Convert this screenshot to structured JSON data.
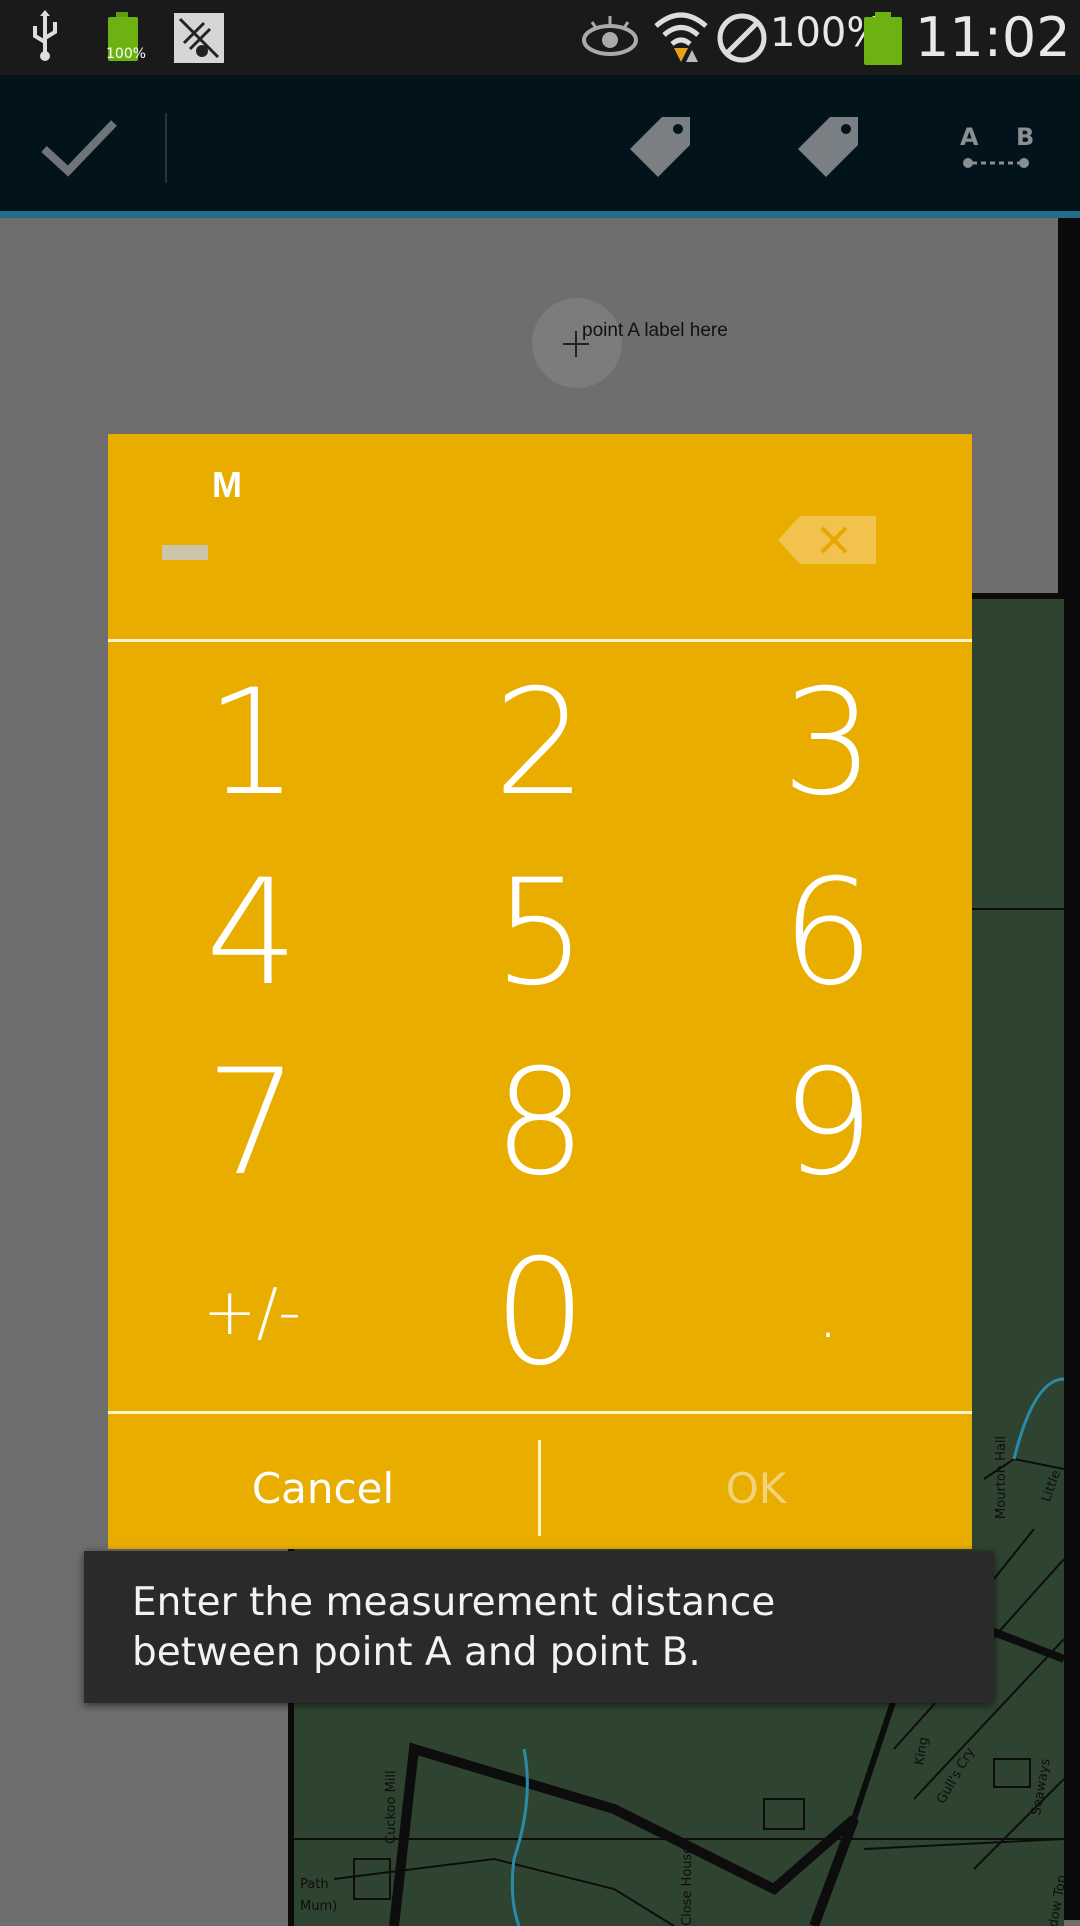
{
  "status_bar": {
    "battery_small_text": "100%",
    "battery_percent": "100%",
    "clock": "11:02"
  },
  "action_bar": {
    "icons": [
      "checkmark-icon",
      "tag-icon",
      "tag-icon",
      "ab-measure-icon"
    ],
    "ab_label_a": "A",
    "ab_label_b": "B"
  },
  "map": {
    "point_label": "point A label here",
    "place_names": [
      "Mourton Hall",
      "Little",
      "Cuckoo Mill",
      "Close House",
      "King",
      "Gull's Cry",
      "Seaways",
      "Path",
      "Mum)",
      "dow Top"
    ]
  },
  "dialog": {
    "unit": "M",
    "display_value": "",
    "keys": [
      [
        "1",
        "2",
        "3"
      ],
      [
        "4",
        "5",
        "6"
      ],
      [
        "7",
        "8",
        "9"
      ],
      [
        "+/-",
        "0",
        "."
      ]
    ],
    "cancel_label": "Cancel",
    "ok_label": "OK",
    "accent_color": "#E9AD00"
  },
  "toast": {
    "message": "Enter the measurement distance between point A and point B."
  }
}
